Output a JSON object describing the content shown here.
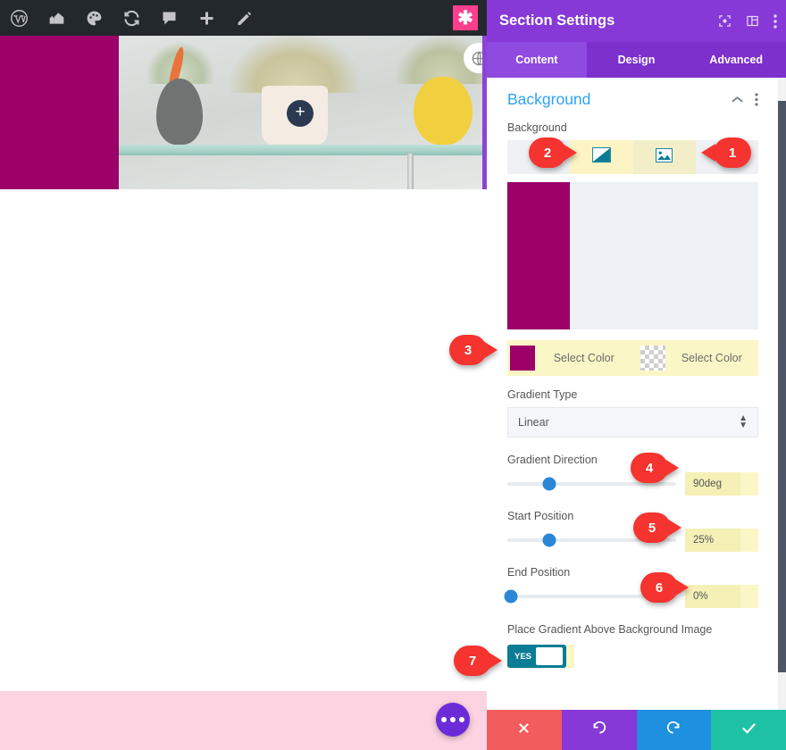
{
  "admin_bar": {
    "icons": [
      {
        "name": "wordpress-logo-icon",
        "glyph": "wp"
      },
      {
        "name": "site-home-icon",
        "glyph": "home"
      },
      {
        "name": "customize-palette-icon",
        "glyph": "palette"
      },
      {
        "name": "refresh-updates-icon",
        "glyph": "refresh"
      },
      {
        "name": "comments-icon",
        "glyph": "comment"
      },
      {
        "name": "new-content-icon",
        "glyph": "plus"
      },
      {
        "name": "edit-page-icon",
        "glyph": "pencil"
      }
    ],
    "asterisk_button_label": "✱"
  },
  "preview": {
    "add_module_label": "+",
    "globe_icon_name": "globe-icon",
    "more_options_label": "•••"
  },
  "panel": {
    "title": "Section Settings",
    "header_icons": [
      {
        "name": "preview-mode-icon"
      },
      {
        "name": "layout-columns-icon"
      },
      {
        "name": "more-vertical-icon"
      }
    ],
    "tabs": [
      {
        "label": "Content",
        "active": true
      },
      {
        "label": "Design",
        "active": false
      },
      {
        "label": "Advanced",
        "active": false
      }
    ],
    "section": {
      "heading": "Background",
      "collapse_icon": "chevron-up-icon",
      "menu_icon": "more-vertical-icon"
    },
    "background": {
      "field_label": "Background",
      "type_tabs": [
        {
          "name": "background-color-tab",
          "icon": "color-swatch-icon",
          "highlighted": false
        },
        {
          "name": "background-gradient-tab",
          "icon": "gradient-icon",
          "highlighted": true
        },
        {
          "name": "background-image-tab",
          "icon": "image-icon",
          "highlighted": true
        },
        {
          "name": "background-video-tab",
          "icon": "video-icon",
          "highlighted": false
        }
      ],
      "preview_start_color": "#9c0068",
      "preview_end_color": "#eef1f5",
      "preview_stop_percent": 25
    },
    "colors": {
      "left_swatch_color": "#9c0068",
      "left_label": "Select Color",
      "right_swatch_color": "transparent",
      "right_label": "Select Color"
    },
    "gradient_type": {
      "label": "Gradient Type",
      "value": "Linear"
    },
    "sliders": [
      {
        "label": "Gradient Direction",
        "value": "90deg",
        "handle_percent": 25
      },
      {
        "label": "Start Position",
        "value": "25%",
        "handle_percent": 25
      },
      {
        "label": "End Position",
        "value": "0%",
        "handle_percent": 2
      }
    ],
    "toggle": {
      "label": "Place Gradient Above Background Image",
      "state_label": "YES",
      "on_color": "#0b7c96"
    },
    "footer_buttons": [
      {
        "name": "close-button",
        "icon": "close-x-icon",
        "color": "#f25c5c"
      },
      {
        "name": "undo-button",
        "icon": "undo-icon",
        "color": "#8639d6"
      },
      {
        "name": "redo-button",
        "icon": "redo-icon",
        "color": "#1f8fe0"
      },
      {
        "name": "save-button",
        "icon": "checkmark-icon",
        "color": "#1fc2a5"
      }
    ]
  },
  "callouts": [
    {
      "number": "1",
      "direction": "left"
    },
    {
      "number": "2",
      "direction": "right"
    },
    {
      "number": "3",
      "direction": "right"
    },
    {
      "number": "4",
      "direction": "right"
    },
    {
      "number": "5",
      "direction": "right"
    },
    {
      "number": "6",
      "direction": "right"
    },
    {
      "number": "7",
      "direction": "right"
    }
  ]
}
